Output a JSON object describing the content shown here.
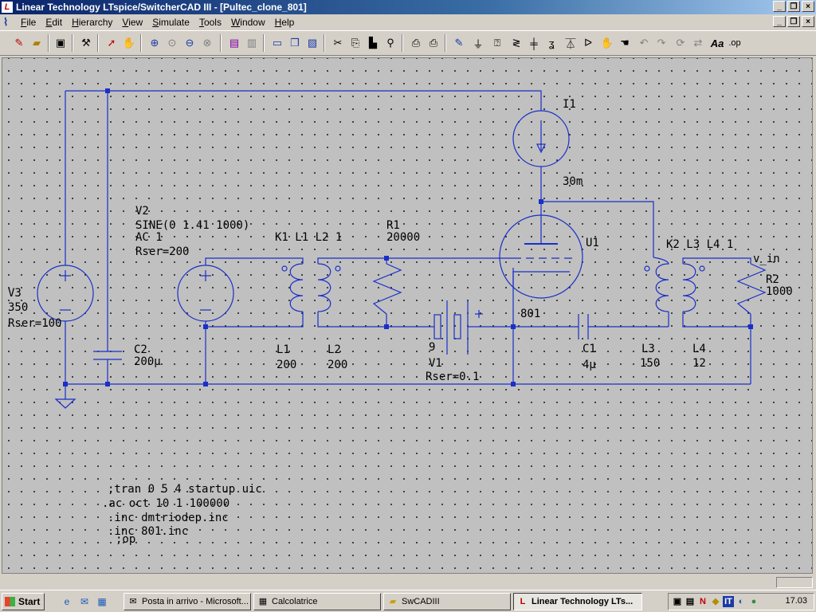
{
  "window": {
    "title": "Linear Technology LTspice/SwitcherCAD III - [Pultec_clone_801]",
    "controls": [
      "_",
      "❒",
      "×"
    ]
  },
  "menus": [
    "File",
    "Edit",
    "Hierarchy",
    "View",
    "Simulate",
    "Tools",
    "Window",
    "Help"
  ],
  "menu_underlines": [
    "F",
    "E",
    "H",
    "V",
    "S",
    "T",
    "W",
    "H"
  ],
  "toolbar": {
    "icons": [
      "new-schematic-icon",
      "open-icon",
      "save-icon",
      "control-panel-icon",
      "run-icon",
      "halt-icon",
      "zoom-in-icon",
      "zoom-pan-icon",
      "zoom-out-icon",
      "zoom-fit-icon",
      "tile-horizontal-icon",
      "tile-vertical-icon",
      "cascade-icon",
      "close-all-icon",
      "cut-icon",
      "copy-icon",
      "paste-icon",
      "find-icon",
      "print-setup-icon",
      "print-icon",
      "wire-icon",
      "ground-icon",
      "label-icon",
      "resistor-icon",
      "capacitor-icon",
      "inductor-icon",
      "diode-icon",
      "component-icon",
      "move-icon",
      "drag-icon",
      "undo-icon",
      "redo-icon",
      "rotate-icon",
      "mirror-icon",
      "text-icon",
      "spice-directive-icon"
    ],
    "text_text": "Aa",
    "op_text": ".op"
  },
  "schematic": {
    "components": {
      "I1": {
        "name": "I1",
        "value": "30m"
      },
      "V2": {
        "name": "V2",
        "value": "SINE(0 1.41 1000)",
        "ac": "AC 1",
        "rser": "Rser=200"
      },
      "V3": {
        "name": "V3",
        "value": "350",
        "rser": "Rser=100"
      },
      "R1": {
        "name": "R1",
        "value": "20000"
      },
      "R2": {
        "name": "R2",
        "value": "1000"
      },
      "U1": {
        "name": "U1",
        "model": "801"
      },
      "K1": {
        "text": "K1 L1 L2 1"
      },
      "K2": {
        "text": "K2 L3 L4 1"
      },
      "L1": {
        "name": "L1",
        "value": "200"
      },
      "L2": {
        "name": "L2",
        "value": "200"
      },
      "L3": {
        "name": "L3",
        "value": "150"
      },
      "L4": {
        "name": "L4",
        "value": "12"
      },
      "C1": {
        "name": "C1",
        "value": "4µ"
      },
      "C2": {
        "name": "C2",
        "value": "200µ"
      },
      "V1": {
        "name": "V1",
        "value": "9",
        "rser": "Rser=0.1"
      }
    },
    "net_label": "v_in",
    "directives": [
      ";tran 0 5 4 startup uic",
      ".ac oct 10 1 100000",
      ".inc dmtriodep.inc",
      ".inc 801.inc",
      ";op"
    ]
  },
  "taskbar": {
    "start": "Start",
    "tasks": [
      {
        "label": "Posta in arrivo - Microsoft...",
        "icon": "mail-icon"
      },
      {
        "label": "Calcolatrice",
        "icon": "calculator-icon"
      },
      {
        "label": "SwCADIII",
        "icon": "folder-icon"
      },
      {
        "label": "Linear Technology LTs...",
        "icon": "ltspice-icon",
        "active": true
      }
    ],
    "clock": "17.03"
  }
}
